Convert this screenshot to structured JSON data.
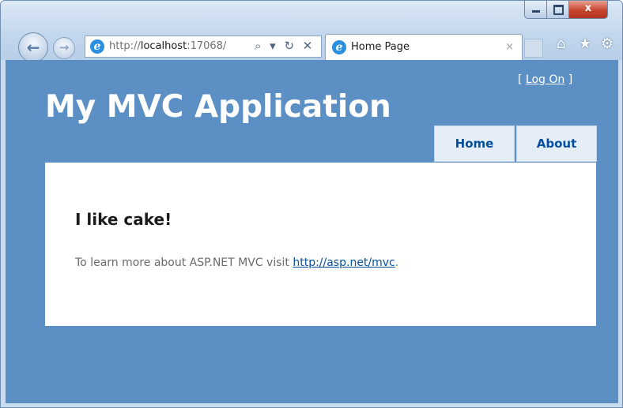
{
  "browser": {
    "url_prefix": "http://",
    "url_host": "localhost",
    "url_suffix": ":17068/",
    "address_tools": "⌕ ▾ ↻ ✕",
    "tab_title": "Home Page",
    "tab_close": "×",
    "toolbar_icons": {
      "home": "⌂",
      "favorites": "★",
      "tools": "⚙"
    },
    "window_controls": {
      "minimize": "",
      "maximize": "",
      "close": "x"
    },
    "nav": {
      "back": "←",
      "forward": "→"
    }
  },
  "site": {
    "title": "My MVC Application",
    "login": {
      "open": "[ ",
      "link": "Log On",
      "close": " ]"
    },
    "menu": [
      {
        "label": "Home"
      },
      {
        "label": "About"
      }
    ],
    "main": {
      "heading": "I like cake!",
      "text_prefix": "To learn more about ASP.NET MVC visit ",
      "link": "http://asp.net/mvc",
      "text_suffix": "."
    }
  },
  "colors": {
    "page_background": "#5c8fc4",
    "menu_background": "#e5eef7",
    "menu_text": "#034e9e",
    "link": "#034e9e"
  }
}
